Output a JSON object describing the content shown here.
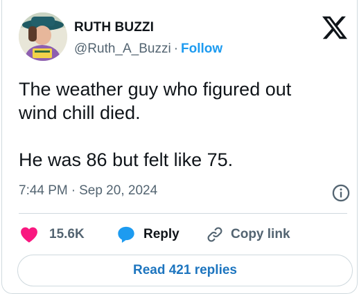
{
  "author": {
    "name": "RUTH BUZZI",
    "handle": "@Ruth_A_Buzzi",
    "separator": "·",
    "follow_label": "Follow"
  },
  "tweet": {
    "lines": [
      "The weather guy who figured out",
      "wind chill died."
    ],
    "punchline": "He was 86 but felt like 75."
  },
  "meta": {
    "time": "7:44 PM",
    "separator": "·",
    "date": "Sep 20, 2024"
  },
  "actions": {
    "like_count": "15.6K",
    "reply_label": "Reply",
    "copy_label": "Copy link"
  },
  "read_replies_label": "Read 421 replies",
  "colors": {
    "accent": "#1d9bf0",
    "like": "#f91880",
    "reply": "#1d9bf0",
    "muted": "#536471",
    "border": "#cfd9de"
  },
  "icons": {
    "logo": "x-logo-icon",
    "info": "info-icon",
    "like": "heart-icon",
    "reply": "speech-bubble-icon",
    "copy": "link-icon"
  }
}
